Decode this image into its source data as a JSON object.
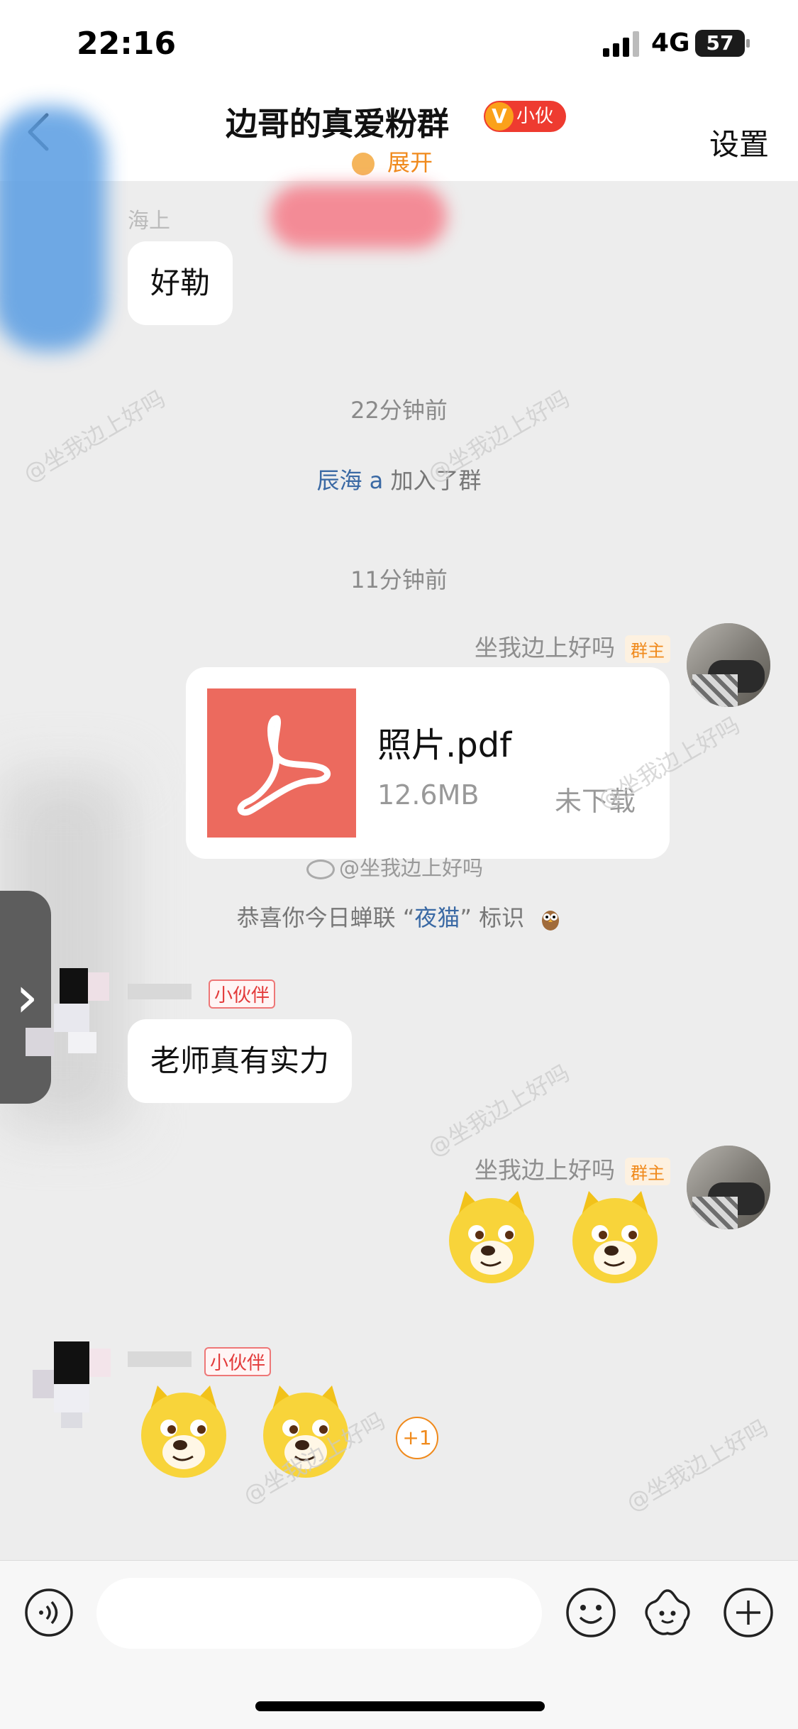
{
  "status_bar": {
    "time": "22:16",
    "network": "4G",
    "battery": "57"
  },
  "header": {
    "title": "边哥的真爱粉群",
    "badge_v": "V",
    "badge_label": "小伙伴",
    "expand_label": "展开",
    "settings_label": "设置"
  },
  "messages": {
    "m1_sender_hint": "海上",
    "m1_text": "好勒",
    "time_22": "22分钟前",
    "join_user": "辰海 a",
    "join_suffix": " 加入了群",
    "time_11": "11分钟前",
    "owner_name": "坐我边上好吗",
    "owner_tag": "群主",
    "file_name": "照片.pdf",
    "file_size": "12.6MB",
    "file_status": "未下载",
    "weibo_mark": "@坐我边上好吗",
    "sys_prefix": "恭喜你今日蝉联 “",
    "sys_highlight": "夜猫",
    "sys_suffix": "” 标识",
    "buddy_tag": "小伙伴",
    "m3_text": "老师真有实力",
    "plus_count": "+1"
  },
  "watermark": "@坐我边上好吗",
  "colors": {
    "accent_orange": "#f08a1c",
    "file_red": "#ec6a5e",
    "link_blue": "#3a69a4",
    "badge_red": "#ee3b30"
  }
}
